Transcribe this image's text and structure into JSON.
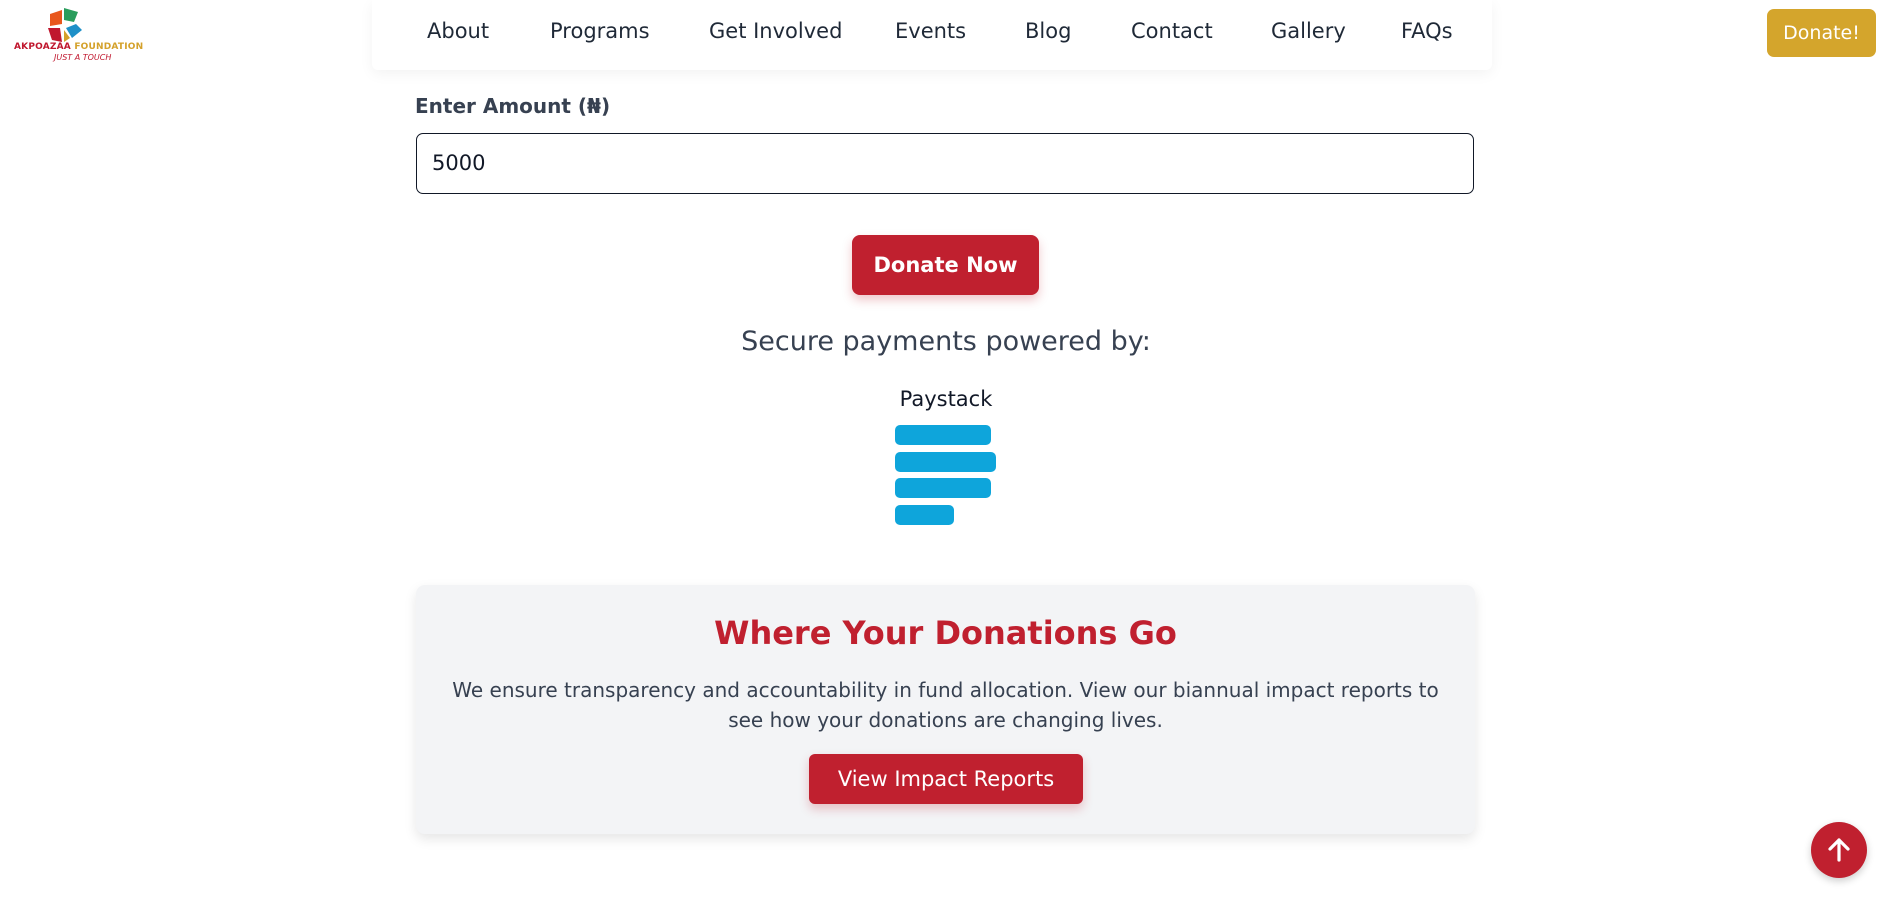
{
  "logo": {
    "name_part1": "AKPOAZAA",
    "name_part2": "FOUNDATION",
    "tagline": "JUST A TOUCH"
  },
  "nav": {
    "items": [
      "About",
      "Programs",
      "Get Involved",
      "Events",
      "Blog",
      "Contact",
      "Gallery",
      "FAQs"
    ],
    "donate_label": "Donate!"
  },
  "form": {
    "amount_label": "Enter Amount (₦)",
    "amount_value": "5000",
    "donate_button": "Donate Now"
  },
  "payments": {
    "heading": "Secure payments powered by:",
    "provider": "Paystack",
    "logo_icon": "paystack-logo-icon"
  },
  "impact": {
    "title": "Where Your Donations Go",
    "body": "We ensure transparency and accountability in fund allocation. View our biannual impact reports to see how your donations are changing lives.",
    "button": "View Impact Reports"
  },
  "colors": {
    "brand_red": "#c0202f",
    "donate_gold": "#d4a52c",
    "paystack_blue": "#0ea5db"
  }
}
